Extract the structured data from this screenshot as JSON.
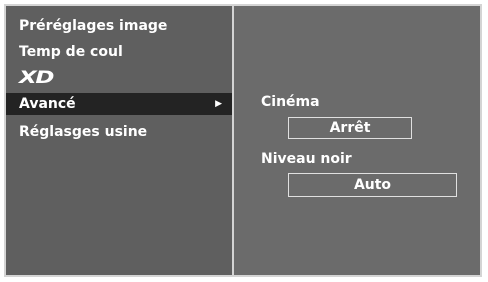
{
  "menu": {
    "items": [
      {
        "label": "Préréglages image"
      },
      {
        "label": "Temp de coul"
      },
      {
        "label": "XD"
      },
      {
        "label": "Avancé",
        "arrow": "▶"
      },
      {
        "label": "Réglasges usine"
      }
    ],
    "selected_index": 3
  },
  "settings": {
    "cinema": {
      "label": "Cinéma",
      "value": "Arrêt"
    },
    "black_level": {
      "label": "Niveau noir",
      "value": "Auto"
    }
  },
  "colors": {
    "frame_border": "#d4d4d4",
    "left_pane": "#5f5f5f",
    "right_pane": "#6b6b6b",
    "selected_row": "#232323",
    "text": "#ffffff"
  },
  "icons": {
    "submenu_arrow": "triangle-right-icon",
    "xd_logo": "xd-logo"
  }
}
